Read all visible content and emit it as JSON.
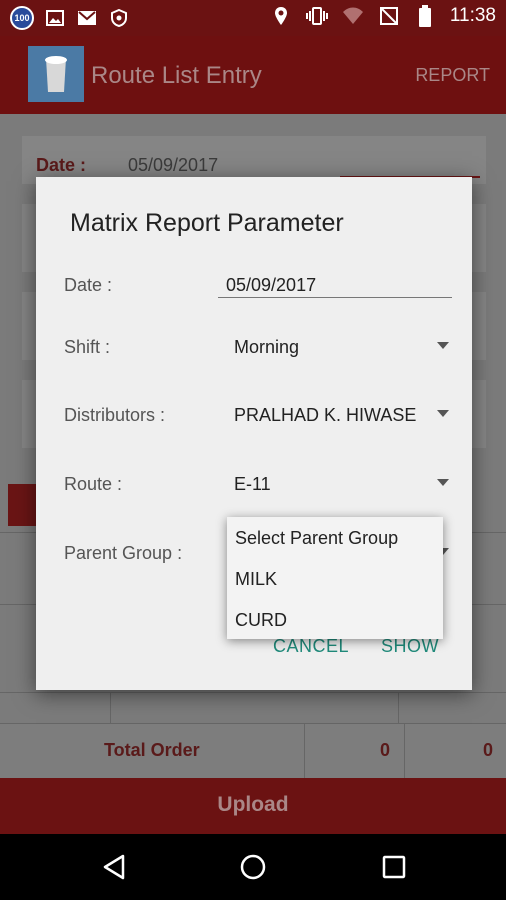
{
  "status_bar": {
    "badge": "100",
    "time": "11:38"
  },
  "app_bar": {
    "title": "Route List Entry",
    "action": "REPORT"
  },
  "background": {
    "date_label": "Date :",
    "date_value": "05/09/2017",
    "total_label": "Total Order",
    "total_value_1": "0",
    "total_value_2": "0",
    "upload_label": "Upload"
  },
  "dialog": {
    "title": "Matrix Report Parameter",
    "fields": {
      "date": {
        "label": "Date :",
        "value": "05/09/2017"
      },
      "shift": {
        "label": "Shift :",
        "value": "Morning"
      },
      "distributors": {
        "label": "Distributors :",
        "value": "PRALHAD K. HIWASE"
      },
      "route": {
        "label": "Route :",
        "value": "E-11"
      },
      "parent_group": {
        "label": "Parent Group :"
      }
    },
    "cancel_label": "CANCEL",
    "show_label": "SHOW"
  },
  "parent_group_dropdown": {
    "options": [
      "Select Parent Group",
      "MILK",
      "CURD"
    ]
  },
  "colors": {
    "primary": "#6e1010",
    "accent": "#1f8a7a"
  }
}
